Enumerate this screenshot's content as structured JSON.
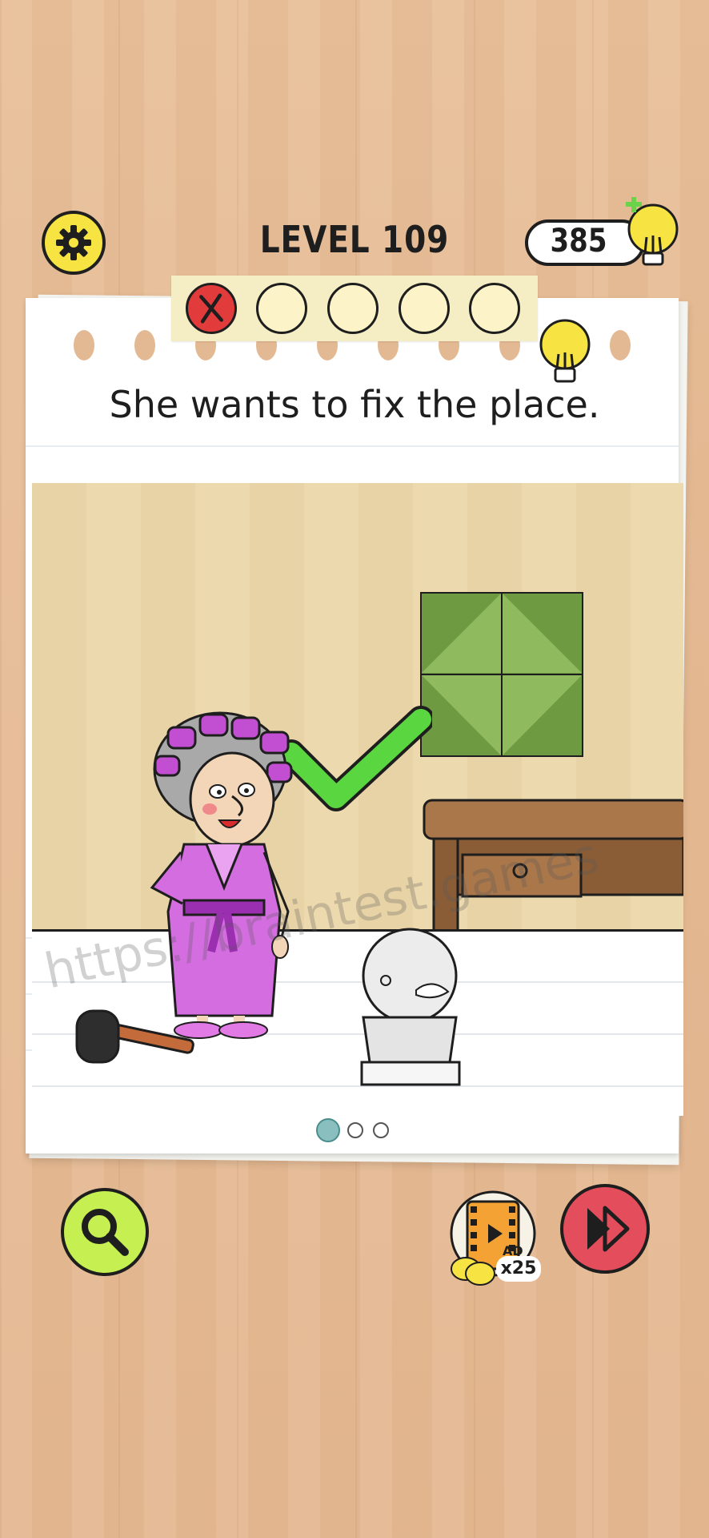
{
  "header": {
    "level_label": "LEVEL 109",
    "hint_count": "385",
    "settings_icon": "gear-icon",
    "hint_icon": "lightbulb-plus-icon"
  },
  "attempts": {
    "total": 5,
    "failed": 1
  },
  "question": "She wants to fix the place.",
  "watermark": "https://braintest.games",
  "pagination": {
    "pages": 3,
    "current": 1
  },
  "buttons": {
    "search_icon": "magnifier-icon",
    "ad_label": "AD",
    "ad_reward": "x25",
    "skip_icon": "fast-forward-icon"
  },
  "colors": {
    "accent_yellow": "#f7e443",
    "search_green": "#c6ef52",
    "skip_red": "#e44d5b",
    "fail_red": "#e23b3b",
    "check_green": "#5ad640",
    "robe_purple": "#d46ee0"
  }
}
